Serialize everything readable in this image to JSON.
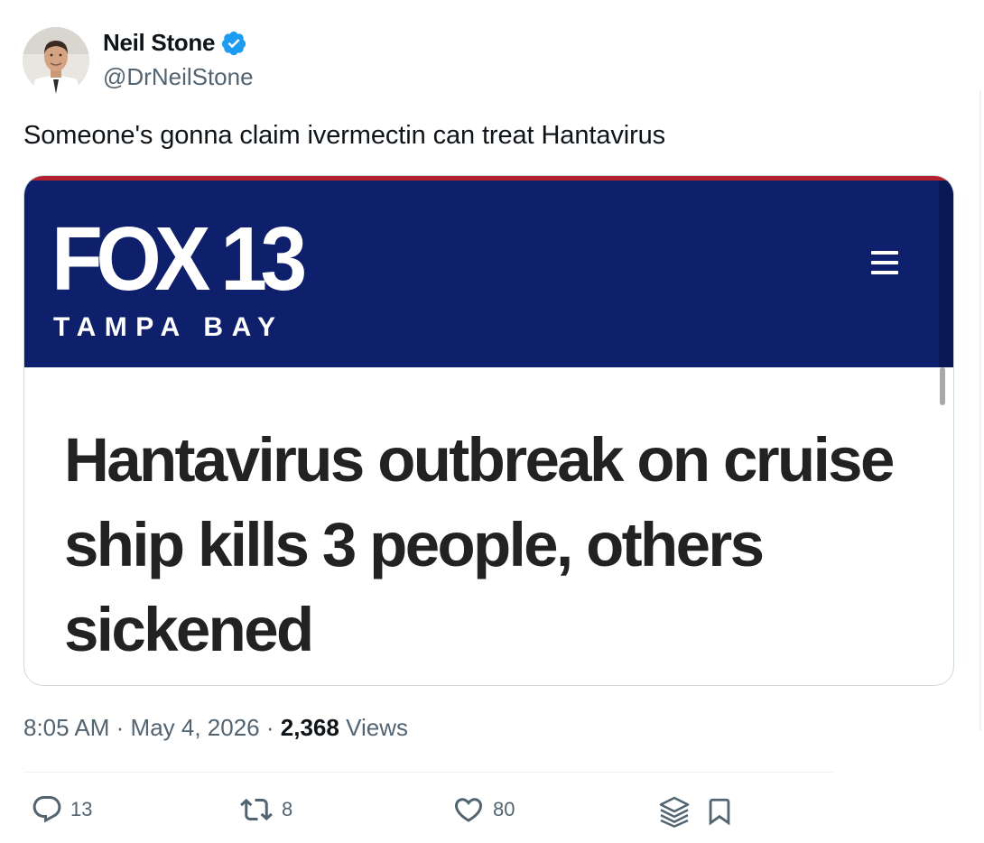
{
  "author": {
    "name": "Neil Stone",
    "handle": "@DrNeilStone",
    "verified": true
  },
  "tweet": {
    "text": "Someone's gonna claim ivermectin can treat Hantavirus"
  },
  "embedded_image": {
    "logo_main": "FOX 13",
    "logo_sub": "TAMPA BAY",
    "headline": "Hantavirus outbreak on cruise ship kills 3 people, others sickened",
    "colors": {
      "banner": "#0e1f6b",
      "top_strip": "#b3212f"
    }
  },
  "meta": {
    "time": "8:05 AM",
    "separator": "·",
    "date": "May 4, 2026",
    "views_count": "2,368",
    "views_label": "Views"
  },
  "actions": {
    "reply_count": "13",
    "retweet_count": "8",
    "like_count": "80"
  },
  "icons": {
    "verified": "verified-badge-icon",
    "reply": "speech-bubble-icon",
    "retweet": "retweet-arrows-icon",
    "like": "heart-icon",
    "grok": "layers-icon",
    "bookmark": "bookmark-icon",
    "menu": "hamburger-icon"
  },
  "colors": {
    "text_primary": "#0f1419",
    "text_secondary": "#536471",
    "verified_blue": "#1d9bf0"
  }
}
